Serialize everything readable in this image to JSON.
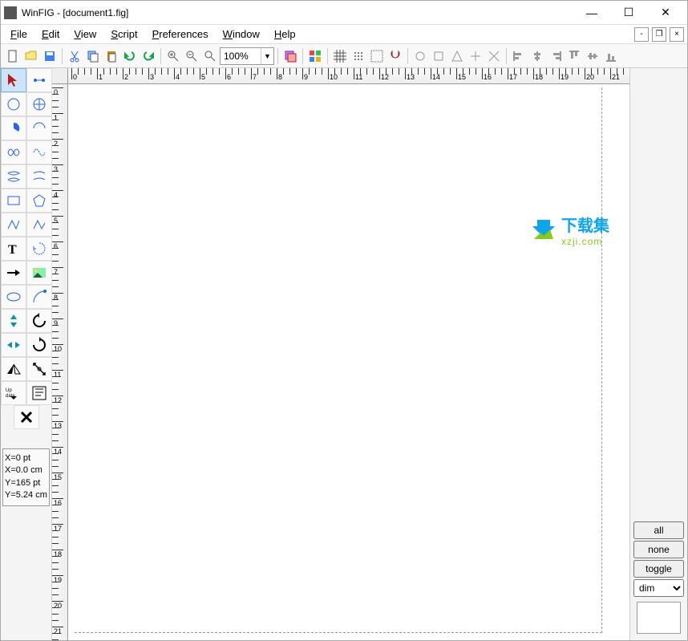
{
  "title": "WinFIG - [document1.fig]",
  "menu": [
    "File",
    "Edit",
    "View",
    "Script",
    "Preferences",
    "Window",
    "Help"
  ],
  "menu_u": [
    "F",
    "E",
    "V",
    "S",
    "P",
    "W",
    "H"
  ],
  "zoom": "100%",
  "coords": {
    "xpt": "X=0 pt",
    "xcm": "X=0.0 cm",
    "ypt": "Y=165 pt",
    "ycm": "Y=5.24 cm"
  },
  "rpanel": {
    "all": "all",
    "none": "none",
    "toggle": "toggle",
    "dim": "dim"
  },
  "hruler_ticks": [
    0,
    1,
    2,
    3,
    4,
    5,
    6,
    7,
    8,
    9,
    10,
    11,
    12,
    13,
    14,
    15,
    16,
    17,
    18,
    19,
    20,
    21
  ],
  "vruler_ticks": [
    0,
    1,
    2,
    3,
    4,
    5,
    6,
    7,
    8,
    9,
    10,
    11,
    12,
    13,
    14,
    15,
    16,
    17,
    18,
    19,
    20,
    21
  ],
  "watermark": {
    "line1": "下载集",
    "line2": "xzji.com"
  },
  "toolbar_icons": [
    "new",
    "open",
    "save",
    "cut",
    "copy",
    "paste",
    "undo",
    "redo",
    "zoom-in",
    "zoom-out",
    "zoom-fit",
    "layers",
    "colors",
    "grid",
    "snap",
    "grid-dots",
    "magnet",
    "shapes1",
    "shapes2",
    "shapes3",
    "shapes4",
    "shapes5",
    "align-left",
    "align-center",
    "align-right",
    "align-top",
    "align-middle",
    "align-bottom"
  ],
  "tools": [
    "select",
    "node-edit",
    "circle",
    "circle-center",
    "pie",
    "arc",
    "spline-closed",
    "spline-open",
    "curve-closed",
    "curve-open",
    "rectangle",
    "polygon",
    "polyline",
    "open-polyline",
    "text",
    "rotate-text",
    "arrow",
    "image",
    "circle-tool",
    "arc-tool",
    "flip-v",
    "rotate-ccw",
    "flip-h",
    "rotate-cw",
    "mirror",
    "shear",
    "update",
    "edit-props",
    "delete"
  ]
}
